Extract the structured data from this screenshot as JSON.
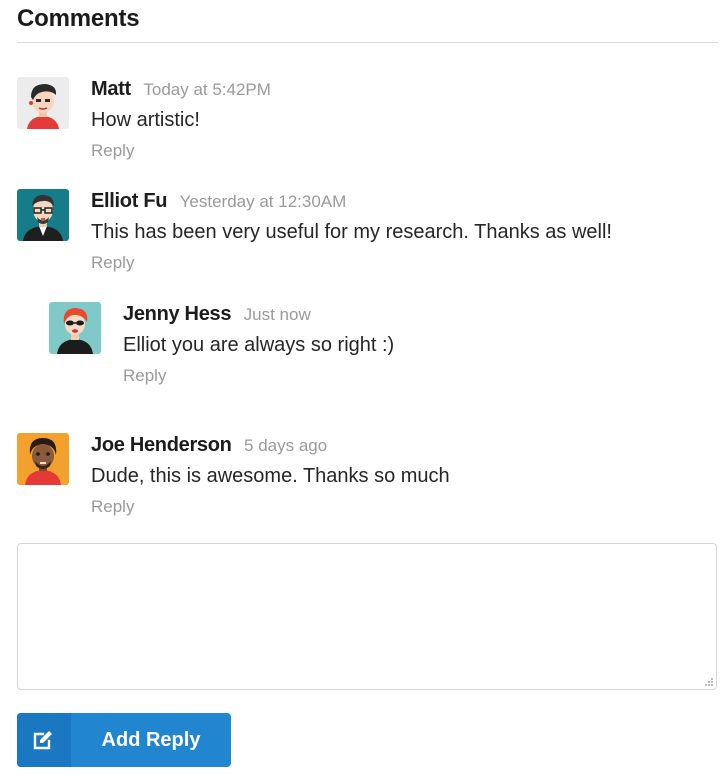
{
  "header": {
    "title": "Comments"
  },
  "comments": [
    {
      "author": "Matt",
      "time": "Today at 5:42PM",
      "text": "How artistic!",
      "reply": "Reply"
    },
    {
      "author": "Elliot Fu",
      "time": "Yesterday at 12:30AM",
      "text": "This has been very useful for my research. Thanks as well!",
      "reply": "Reply",
      "replies": [
        {
          "author": "Jenny Hess",
          "time": "Just now",
          "text": "Elliot you are always so right :)",
          "reply": "Reply"
        }
      ]
    },
    {
      "author": "Joe Henderson",
      "time": "5 days ago",
      "text": "Dude, this is awesome. Thanks so much",
      "reply": "Reply"
    }
  ],
  "form": {
    "textarea_value": "",
    "submit_label": "Add Reply",
    "submit_icon": "edit-icon"
  },
  "colors": {
    "primary": "#2185d0",
    "primary_dark": "#1a78c2",
    "meta": "#9a9a9a"
  }
}
